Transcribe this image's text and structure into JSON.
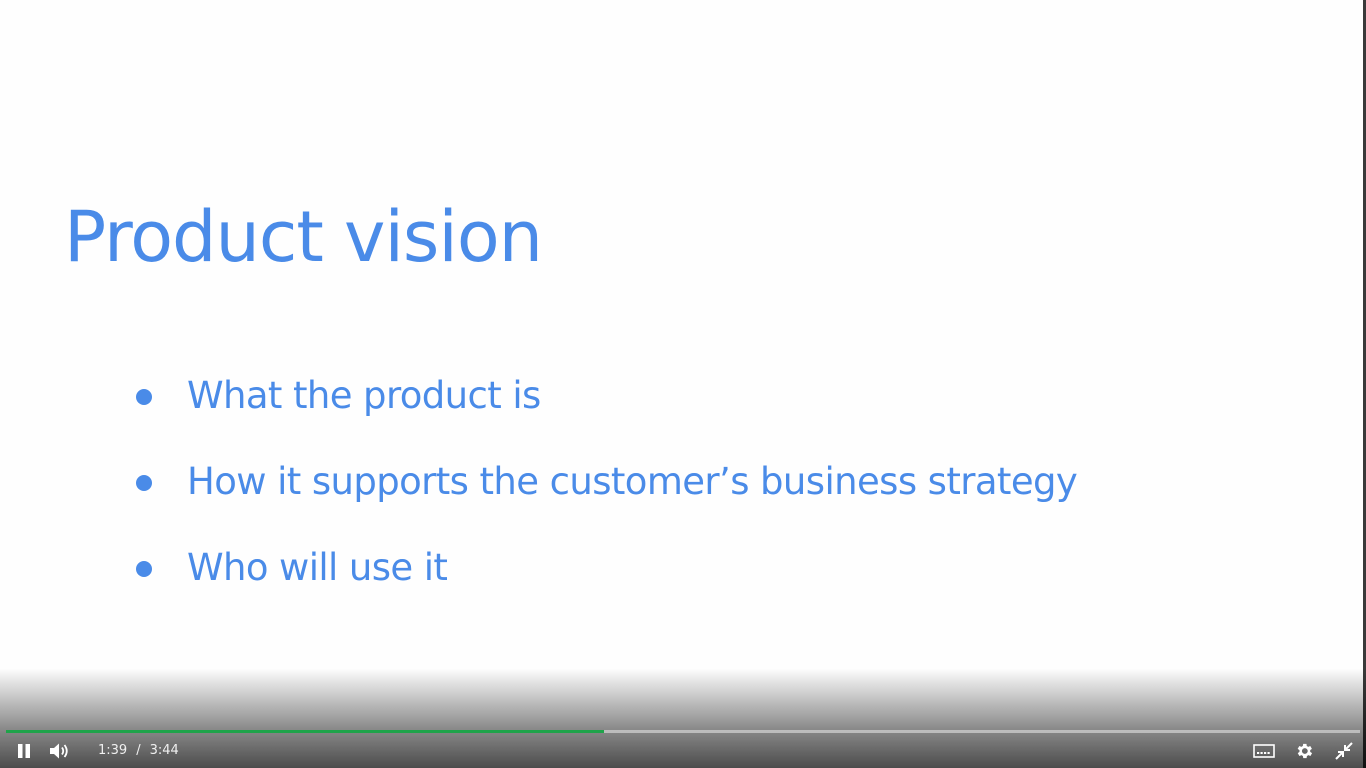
{
  "slide": {
    "title": "Product vision",
    "bullets": [
      "What the product is",
      "How it supports the customer’s business strategy",
      "Who will use it"
    ]
  },
  "player": {
    "current_time": "1:39",
    "time_separator": "/",
    "duration": "3:44",
    "progress_fraction": 0.442,
    "progress_color": "#1fa34a",
    "accent_color": "#4a8be8",
    "icons": {
      "play_pause": "pause-icon",
      "volume": "volume-icon",
      "captions": "captions-icon",
      "settings": "gear-icon",
      "fullscreen": "exit-fullscreen-icon"
    }
  }
}
